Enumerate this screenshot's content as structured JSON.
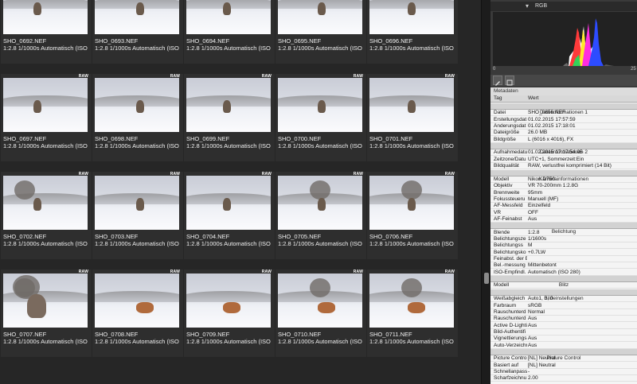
{
  "thumbnails": [
    {
      "file": "SHO_0692.NEF",
      "info": "1:2.8 1/1000s Automatisch (ISO"
    },
    {
      "file": "SHO_0693.NEF",
      "info": "1:2.8 1/1000s Automatisch (ISO"
    },
    {
      "file": "SHO_0694.NEF",
      "info": "1:2.8 1/1000s Automatisch (ISO"
    },
    {
      "file": "SHO_0695.NEF",
      "info": "1:2.8 1/1000s Automatisch (ISO"
    },
    {
      "file": "SHO_0696.NEF",
      "info": "1:2.8 1/1000s Automatisch (ISO"
    },
    {
      "file": "SHO_0697.NEF",
      "info": "1:2.8 1/1000s Automatisch (ISO"
    },
    {
      "file": "SHO_0698.NEF",
      "info": "1:2.8 1/1000s Automatisch (ISO"
    },
    {
      "file": "SHO_0699.NEF",
      "info": "1:2.8 1/1000s Automatisch (ISO"
    },
    {
      "file": "SHO_0700.NEF",
      "info": "1:2.8 1/1000s Automatisch (ISO"
    },
    {
      "file": "SHO_0701.NEF",
      "info": "1:2.8 1/1000s Automatisch (ISO"
    },
    {
      "file": "SHO_0702.NEF",
      "info": "1:2.8 1/1000s Automatisch (ISO"
    },
    {
      "file": "SHO_0703.NEF",
      "info": "1:2.8 1/1000s Automatisch (ISO"
    },
    {
      "file": "SHO_0704.NEF",
      "info": "1:2.8 1/1000s Automatisch (ISO"
    },
    {
      "file": "SHO_0705.NEF",
      "info": "1:2.8 1/1000s Automatisch (ISO"
    },
    {
      "file": "SHO_0706.NEF",
      "info": "1:2.8 1/1000s Automatisch (ISO"
    },
    {
      "file": "SHO_0707.NEF",
      "info": "1:2.8 1/1000s Automatisch (ISO"
    },
    {
      "file": "SHO_0708.NEF",
      "info": "1:2.8 1/1000s Automatisch (ISO"
    },
    {
      "file": "SHO_0709.NEF",
      "info": "1:2.8 1/1000s Automatisch (ISO"
    },
    {
      "file": "SHO_0710.NEF",
      "info": "1:2.8 1/1000s Automatisch (ISO"
    },
    {
      "file": "SHO_0711.NEF",
      "info": "1:2.8 1/1000s Automatisch (ISO"
    }
  ],
  "raw_badge": "RAW",
  "histogram": {
    "channel": "RGB",
    "range_min": "0",
    "range_max": "25"
  },
  "metadata_panel_title": "Metadaten",
  "table_header": {
    "tag": "Tag",
    "value": "Wert"
  },
  "metadata": [
    {
      "section": "Dateiinformationen 1"
    },
    {
      "k": "Datei",
      "v": "SHO_0656.NEF"
    },
    {
      "k": "Erstellungsdat",
      "v": "01.02.2015 17:57:59"
    },
    {
      "k": "Änderungsdat",
      "v": "01.02.2015 17:18:01"
    },
    {
      "k": "Dateigröße",
      "v": "26.0 MB"
    },
    {
      "k": "Bildgröße",
      "v": "L (6016 x 4016), FX"
    },
    {
      "section": "Dateiinformationen 2"
    },
    {
      "k": "Aufnahmedatu",
      "v": "01.02.2015 17:17:54.05"
    },
    {
      "k": "Zeitzone/Datu",
      "v": "UTC+1, Sommerzeit:Ein"
    },
    {
      "k": "Bildqualität",
      "v": "RAW, verlustfrei komprimiert (14 Bit)"
    },
    {
      "section": "Kamerainformationen"
    },
    {
      "k": "Modell",
      "v": "Nikon D750"
    },
    {
      "k": "Objektiv",
      "v": "VR 70-200mm 1:2.8G"
    },
    {
      "k": "Brennweite",
      "v": "95mm"
    },
    {
      "k": "Fokussteueru",
      "v": "Manuell (MF)"
    },
    {
      "k": "AF-Messfeld",
      "v": "Einzelfeld"
    },
    {
      "k": "VR",
      "v": "OFF"
    },
    {
      "k": "AF-Feinabst",
      "v": "Aus"
    },
    {
      "section": "Belichtung"
    },
    {
      "k": "Blende",
      "v": "1:2.8"
    },
    {
      "k": "Belichtungsze",
      "v": "1/1600s"
    },
    {
      "k": "Belichtungss",
      "v": "M"
    },
    {
      "k": "Belichtungsko",
      "v": "+0.7LW"
    },
    {
      "k": "Feinabst. der B",
      "v": ""
    },
    {
      "k": "Bel.-messung",
      "v": "Mittenbetont"
    },
    {
      "k": "ISO-Empfindl.",
      "v": "Automatisch (ISO 280)"
    },
    {
      "section": "Blitz"
    },
    {
      "k": "Modell",
      "v": ""
    },
    {
      "section": "Bildeinstellungen"
    },
    {
      "k": "Weißabgleich",
      "v": "Auto1, 0, 0"
    },
    {
      "k": "Farbraum",
      "v": "sRGB"
    },
    {
      "k": "Rauschunterd",
      "v": "Normal"
    },
    {
      "k": "Rauschunterd",
      "v": "Aus"
    },
    {
      "k": "Active D-Lighti",
      "v": "Aus"
    },
    {
      "k": "Bild-Authentifi",
      "v": ""
    },
    {
      "k": "Vignettierungs",
      "v": "Aus"
    },
    {
      "k": "Auto-Verzeichr",
      "v": "Aus"
    },
    {
      "section": "Picture Control"
    },
    {
      "k": "Picture Contro",
      "v": "[NL] Neutral"
    },
    {
      "k": "Basiert auf",
      "v": "[NL] Neutral"
    },
    {
      "k": "Schnellanpass",
      "v": "-"
    },
    {
      "k": "Scharfzeichnu",
      "v": "2.00"
    }
  ]
}
